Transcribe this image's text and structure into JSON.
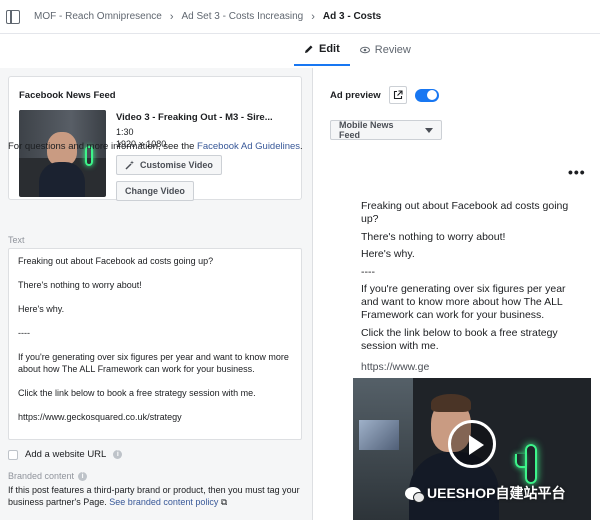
{
  "breadcrumb": [
    "MOF - Reach Omnipresence",
    "Ad Set 3 - Costs Increasing",
    "Ad 3 - Costs"
  ],
  "tabs": {
    "edit": "Edit",
    "review": "Review"
  },
  "card": {
    "title": "Facebook News Feed",
    "video_title": "Video 3 - Freaking Out - M3 - Sire...",
    "duration": "1:30",
    "dimensions": "1920 × 1080",
    "customise_label": "Customise Video",
    "change_label": "Change Video"
  },
  "guidelines": {
    "prefix": "For questions and more information, see the",
    "link": "Facebook Ad Guidelines",
    "suffix": "."
  },
  "text_label": "Text",
  "primary_text": [
    "Freaking out about Facebook ad costs going up?",
    "There's nothing to worry about!",
    "Here's why.",
    "----",
    "If you're generating over six figures per year and want to know more about how The ALL Framework can work for your business.",
    "Click the link below to book a free strategy session with me.",
    "https://www.geckosquared.co.uk/strategy"
  ],
  "website_url_label": "Add a website URL",
  "branded": {
    "label": "Branded content",
    "desc": "If this post features a third-party brand or product, then you must tag your business partner's Page.",
    "link": "See branded content policy"
  },
  "preview": {
    "label": "Ad preview",
    "placement": "Mobile News Feed",
    "dots": "•••",
    "text": [
      "Freaking out about Facebook ad costs going up?",
      "There's nothing to worry about!",
      "Here's why.",
      "----",
      "If you're generating over six figures per year and want to know more about how The ALL Framework can work for your business.",
      "Click the link below to book a free strategy session with me."
    ],
    "link": "https://www.ge"
  },
  "watermark": "UEESHOP自建站平台",
  "colors": {
    "accent": "#1877f2",
    "link": "#385898",
    "neon": "#3df58a"
  }
}
